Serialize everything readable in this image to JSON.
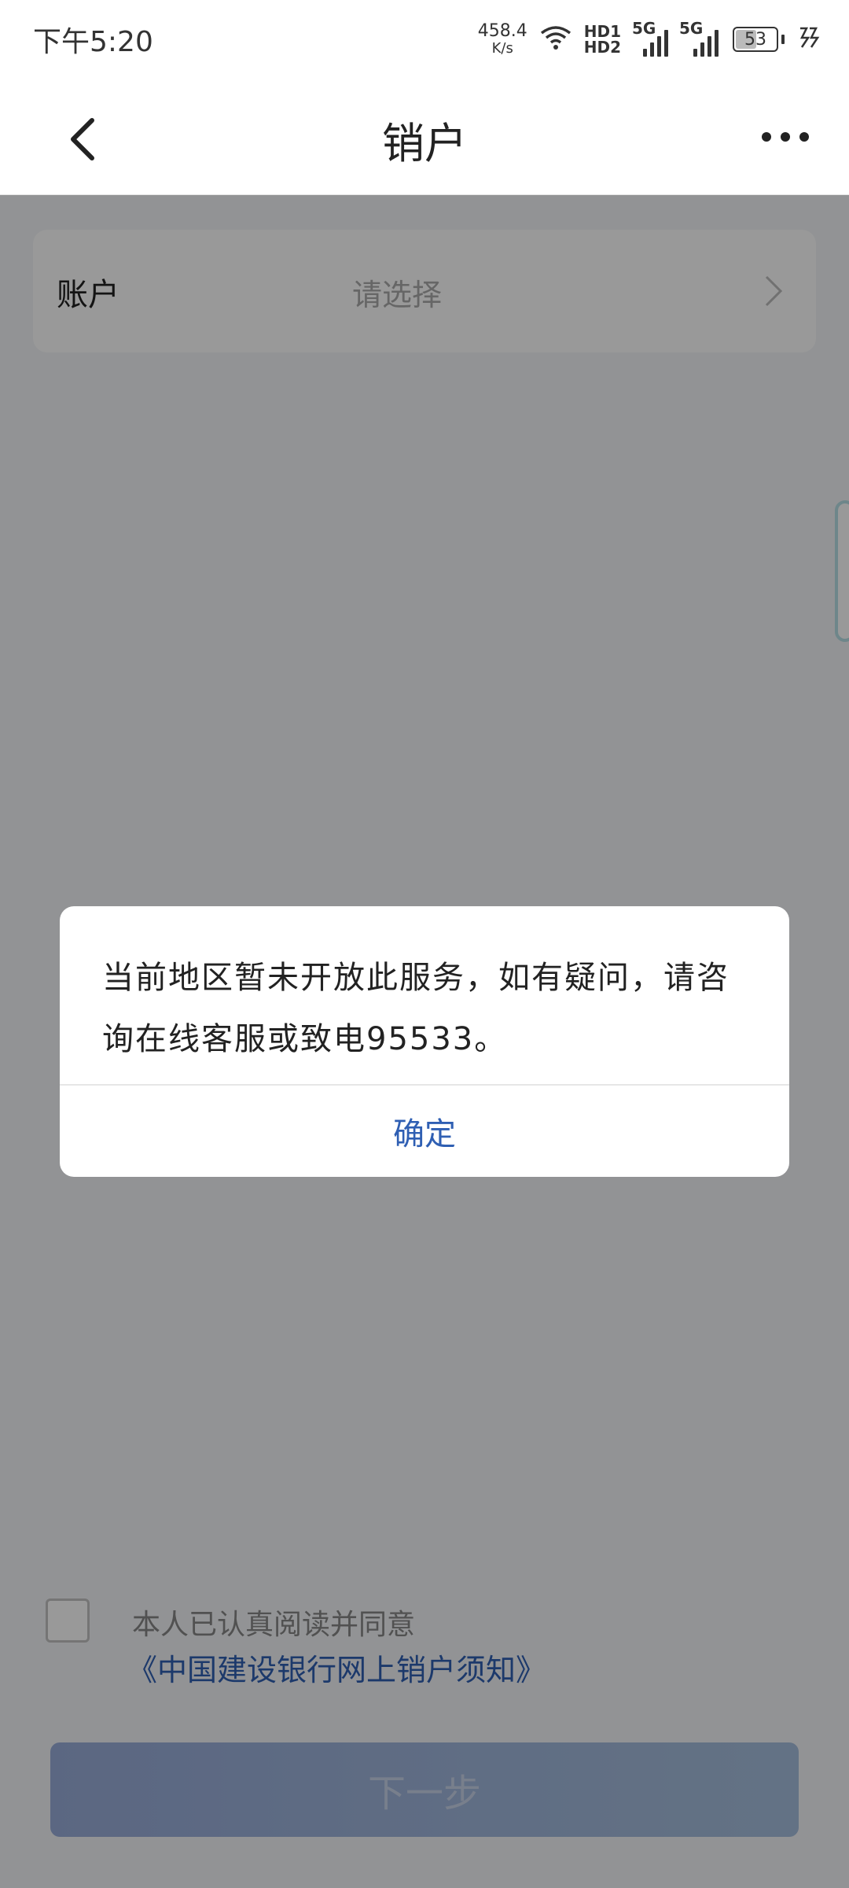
{
  "status_bar": {
    "time": "下午5:20",
    "net_speed_value": "458.4",
    "net_speed_unit": "K/s",
    "hd1": "HD1",
    "hd2": "HD2",
    "sim1_label": "5G",
    "sim2_label": "5G",
    "battery": "53"
  },
  "nav": {
    "title": "销户"
  },
  "account": {
    "label": "账户",
    "value_placeholder": "请选择"
  },
  "agreement": {
    "text": "本人已认真阅读并同意",
    "link": "《中国建设银行网上销户须知》",
    "checked": false
  },
  "next_button": {
    "label": "下一步"
  },
  "dialog": {
    "message": "当前地区暂未开放此服务，如有疑问，请咨询在线客服或致电95533。",
    "confirm": "确定"
  },
  "colors": {
    "link_blue": "#2f5fb3",
    "button_blue": "#98acd9",
    "overlay": "rgba(0,0,0,0.4)"
  }
}
